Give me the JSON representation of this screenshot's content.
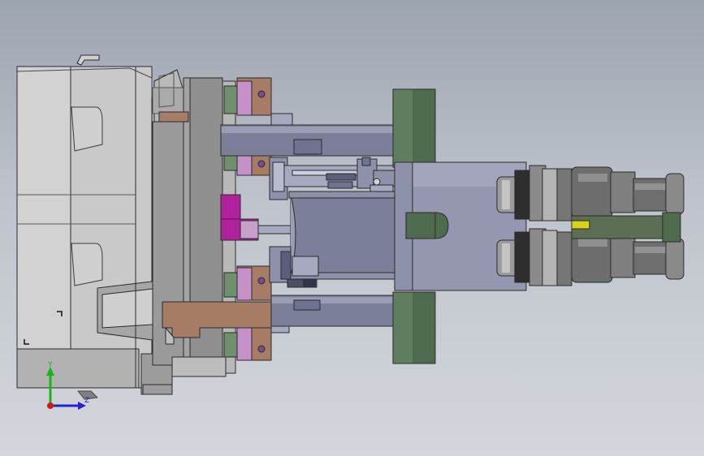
{
  "viewport": {
    "background_top": "#9ca4b0",
    "background_bottom": "#d3d6dc"
  },
  "colors": {
    "housing_light": "#c7c7c7",
    "housing_mid": "#a9a9a9",
    "housing_dark": "#8e8e8e",
    "edge": "#2b2b2b",
    "slate": "#8487a0",
    "slate_dark": "#6f7290",
    "slate_light": "#a6a9bf",
    "copper": "#a67c64",
    "magenta": "#b0219c",
    "violet_pad": "#c690c9",
    "green_block": "#4f6b4f",
    "green_pad": "#6f8f6f",
    "fitting_grey": "#6d6d6d",
    "fitting_light": "#a3a3a3",
    "yellow_pin": "#d8d21a"
  },
  "triad": {
    "y_label": "Y",
    "z_label": "Z",
    "y_color": "#19b419",
    "z_color": "#2222d0",
    "origin_color": "#d01919"
  }
}
